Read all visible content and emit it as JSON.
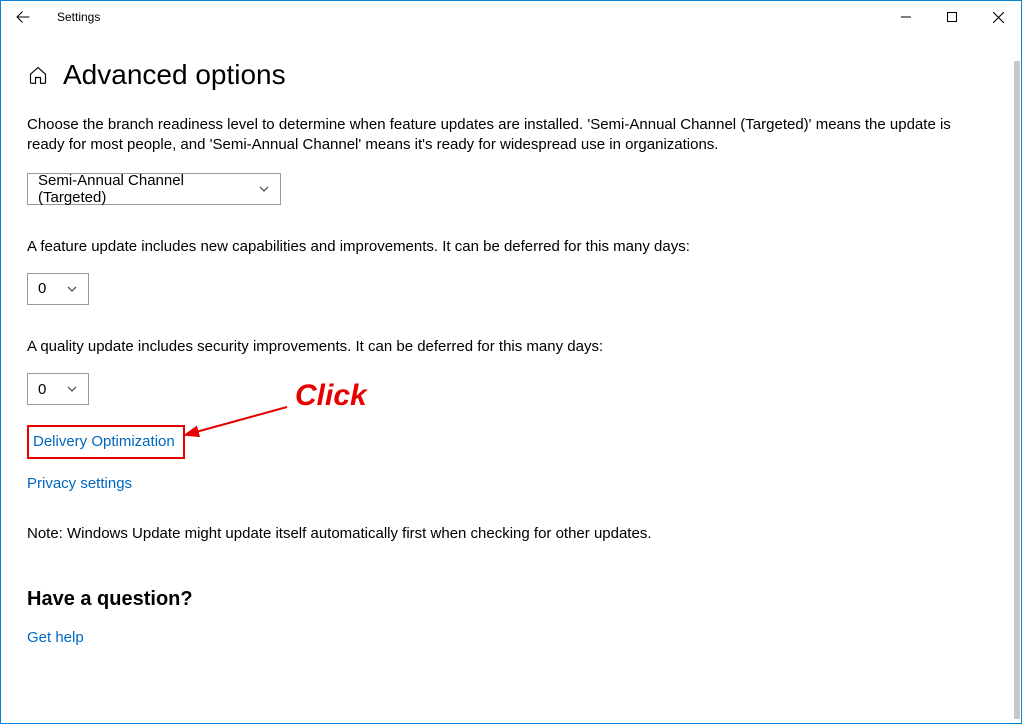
{
  "window": {
    "title": "Settings"
  },
  "page": {
    "title": "Advanced options",
    "branch_text": "Choose the branch readiness level to determine when feature updates are installed. 'Semi-Annual Channel (Targeted)' means the update is ready for most people, and 'Semi-Annual Channel' means it's ready for widespread use in organizations.",
    "branch_value": "Semi-Annual Channel (Targeted)",
    "feature_text": "A feature update includes new capabilities and improvements. It can be deferred for this many days:",
    "feature_value": "0",
    "quality_text": "A quality update includes security improvements. It can be deferred for this many days:",
    "quality_value": "0",
    "delivery_link": "Delivery Optimization",
    "privacy_link": "Privacy settings",
    "note": "Note: Windows Update might update itself automatically first when checking for other updates.",
    "question_heading": "Have a question?",
    "get_help_link": "Get help"
  },
  "annotation": {
    "label": "Click"
  }
}
